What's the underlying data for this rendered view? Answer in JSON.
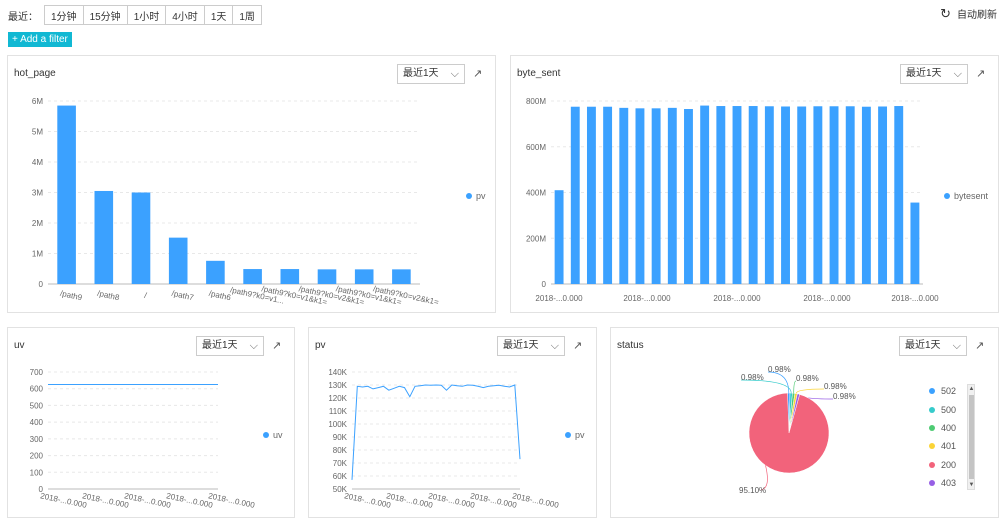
{
  "toolbar": {
    "recent_label": "最近：",
    "ranges": [
      "1分钟",
      "15分钟",
      "1小时",
      "4小时",
      "1天",
      "1周"
    ],
    "auto_refresh": "自动刷新",
    "add_filter": "+ Add a filter"
  },
  "panels": {
    "hot_page": {
      "title": "hot_page",
      "range": "最近1天",
      "legend": "pv"
    },
    "byte_sent": {
      "title": "byte_sent",
      "range": "最近1天",
      "legend": "bytesent"
    },
    "uv": {
      "title": "uv",
      "range": "最近1天",
      "legend": "uv"
    },
    "pv": {
      "title": "pv",
      "range": "最近1天",
      "legend": "pv"
    },
    "status": {
      "title": "status",
      "range": "最近1天"
    }
  },
  "colors": {
    "accent": "#3ba1ff",
    "button": "#11b8d3"
  },
  "chart_data": [
    {
      "id": "hot_page",
      "type": "bar",
      "categories": [
        "/path9",
        "/path8",
        "/",
        "/path7",
        "/path6",
        "/path9?k0=v1...",
        "/path9?k0=v1&k1=...",
        "/path9?k0=v2&k1=...",
        "/path9?k0=v1&k1=...",
        "/path9?k0=v2&k1=..."
      ],
      "values": [
        5850000,
        3050000,
        3000000,
        1520000,
        760000,
        490000,
        490000,
        480000,
        480000,
        480000
      ],
      "ylim": [
        0,
        6000000
      ],
      "yticks": [
        "0",
        "1M",
        "2M",
        "3M",
        "4M",
        "5M",
        "6M"
      ],
      "series_name": "pv"
    },
    {
      "id": "byte_sent",
      "type": "bar",
      "xticks": [
        "2018-...0.000",
        "2018-...0.000",
        "2018-...0.000",
        "2018-...0.000",
        "2018-...0.000"
      ],
      "values": [
        410,
        775,
        775,
        775,
        770,
        768,
        768,
        770,
        765,
        780,
        778,
        778,
        778,
        777,
        776,
        776,
        777,
        777,
        777,
        775,
        776,
        778,
        356
      ],
      "ylim": [
        0,
        800
      ],
      "yticks": [
        "0",
        "200M",
        "400M",
        "600M",
        "800M"
      ],
      "series_name": "bytesent"
    },
    {
      "id": "uv",
      "type": "line",
      "xticks": [
        "2018-...0.000",
        "2018-...0.000",
        "2018-...0.000",
        "2018-...0.000",
        "2018-...0.000"
      ],
      "values": [
        625,
        625
      ],
      "ylim": [
        0,
        700
      ],
      "yticks": [
        "0",
        "100",
        "200",
        "300",
        "400",
        "500",
        "600",
        "700"
      ],
      "series_name": "uv"
    },
    {
      "id": "pv",
      "type": "line",
      "xticks": [
        "2018-...0.000",
        "2018-...0.000",
        "2018-...0.000",
        "2018-...0.000",
        "2018-...0.000"
      ],
      "values": [
        57000,
        129000,
        128500,
        129000,
        127000,
        128000,
        129000,
        126000,
        127500,
        129000,
        128000,
        121000,
        129000,
        129500,
        130000,
        129800,
        130000,
        129800,
        126000,
        130000,
        129500,
        129000,
        130000,
        129800,
        129000,
        128000,
        129000,
        129500,
        129800,
        129000,
        128500,
        130000,
        73000
      ],
      "ylim": [
        50000,
        140000
      ],
      "yticks": [
        "50K",
        "60K",
        "70K",
        "80K",
        "90K",
        "100K",
        "110K",
        "120K",
        "130K",
        "140K"
      ],
      "series_name": "pv"
    },
    {
      "id": "status",
      "type": "pie",
      "categories": [
        "502",
        "500",
        "400",
        "401",
        "200",
        "403"
      ],
      "values": [
        0.98,
        0.98,
        0.98,
        0.98,
        95.1,
        0.98
      ],
      "labels": [
        "0.98%",
        "0.98%",
        "0.98%",
        "0.98%",
        "95.10%",
        "0.98%"
      ],
      "colors": [
        "#3ba1ff",
        "#36cbcb",
        "#4ecb73",
        "#fbd437",
        "#f2637b",
        "#975fe5"
      ]
    }
  ]
}
